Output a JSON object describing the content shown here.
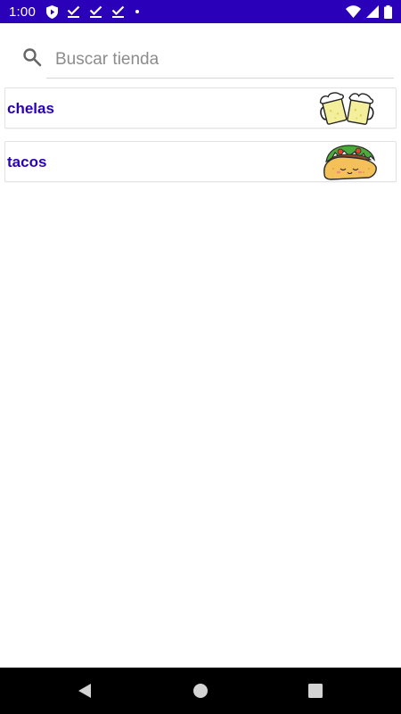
{
  "status_bar": {
    "time": "1:00",
    "background_color": "#2a00b8",
    "left_icons": [
      "shield-play-icon",
      "download-check-icon",
      "download-check-icon",
      "download-check-icon",
      "dot-icon"
    ],
    "right_icons": [
      "wifi-icon",
      "signal-icon",
      "battery-icon"
    ]
  },
  "search": {
    "placeholder": "Buscar tienda",
    "value": "",
    "icon": "search-icon"
  },
  "stores": [
    {
      "name": "chelas",
      "image_icon": "beer-mugs-icon"
    },
    {
      "name": "tacos",
      "image_icon": "taco-icon"
    }
  ],
  "theme": {
    "accent_color": "#2a00b8"
  },
  "nav_bar": {
    "buttons": [
      "back-icon",
      "home-icon",
      "recents-icon"
    ]
  }
}
